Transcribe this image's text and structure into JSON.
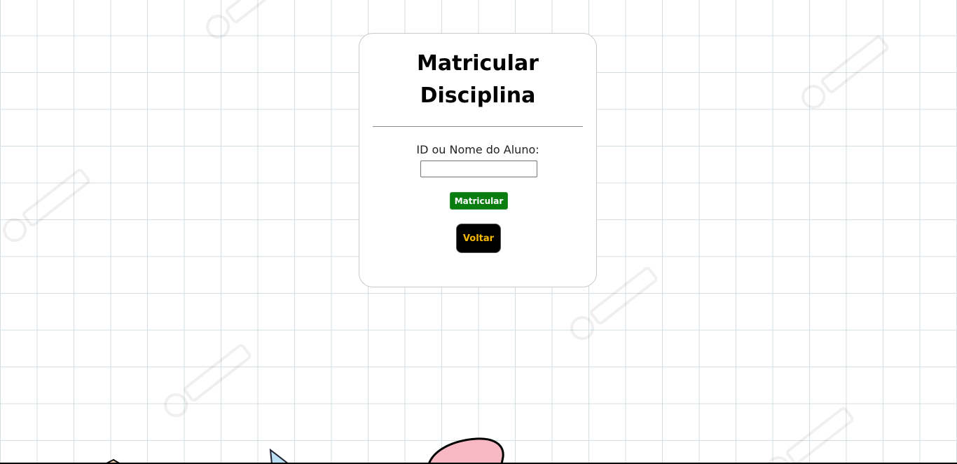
{
  "form": {
    "title_line1": "Matricular",
    "title_line2": "Disciplina",
    "student_label": "ID ou Nome do Aluno:",
    "student_value": "",
    "submit_label": "Matricular",
    "back_label": "Voltar"
  },
  "colors": {
    "submit_bg": "#0a7d10",
    "back_bg": "#000000",
    "back_text": "#f5b800",
    "grid_line": "#d3dde2"
  },
  "decor": {
    "watermark_icon": "freepik-watermark-icon",
    "illustration": "cartoon-doodle-illustration"
  }
}
